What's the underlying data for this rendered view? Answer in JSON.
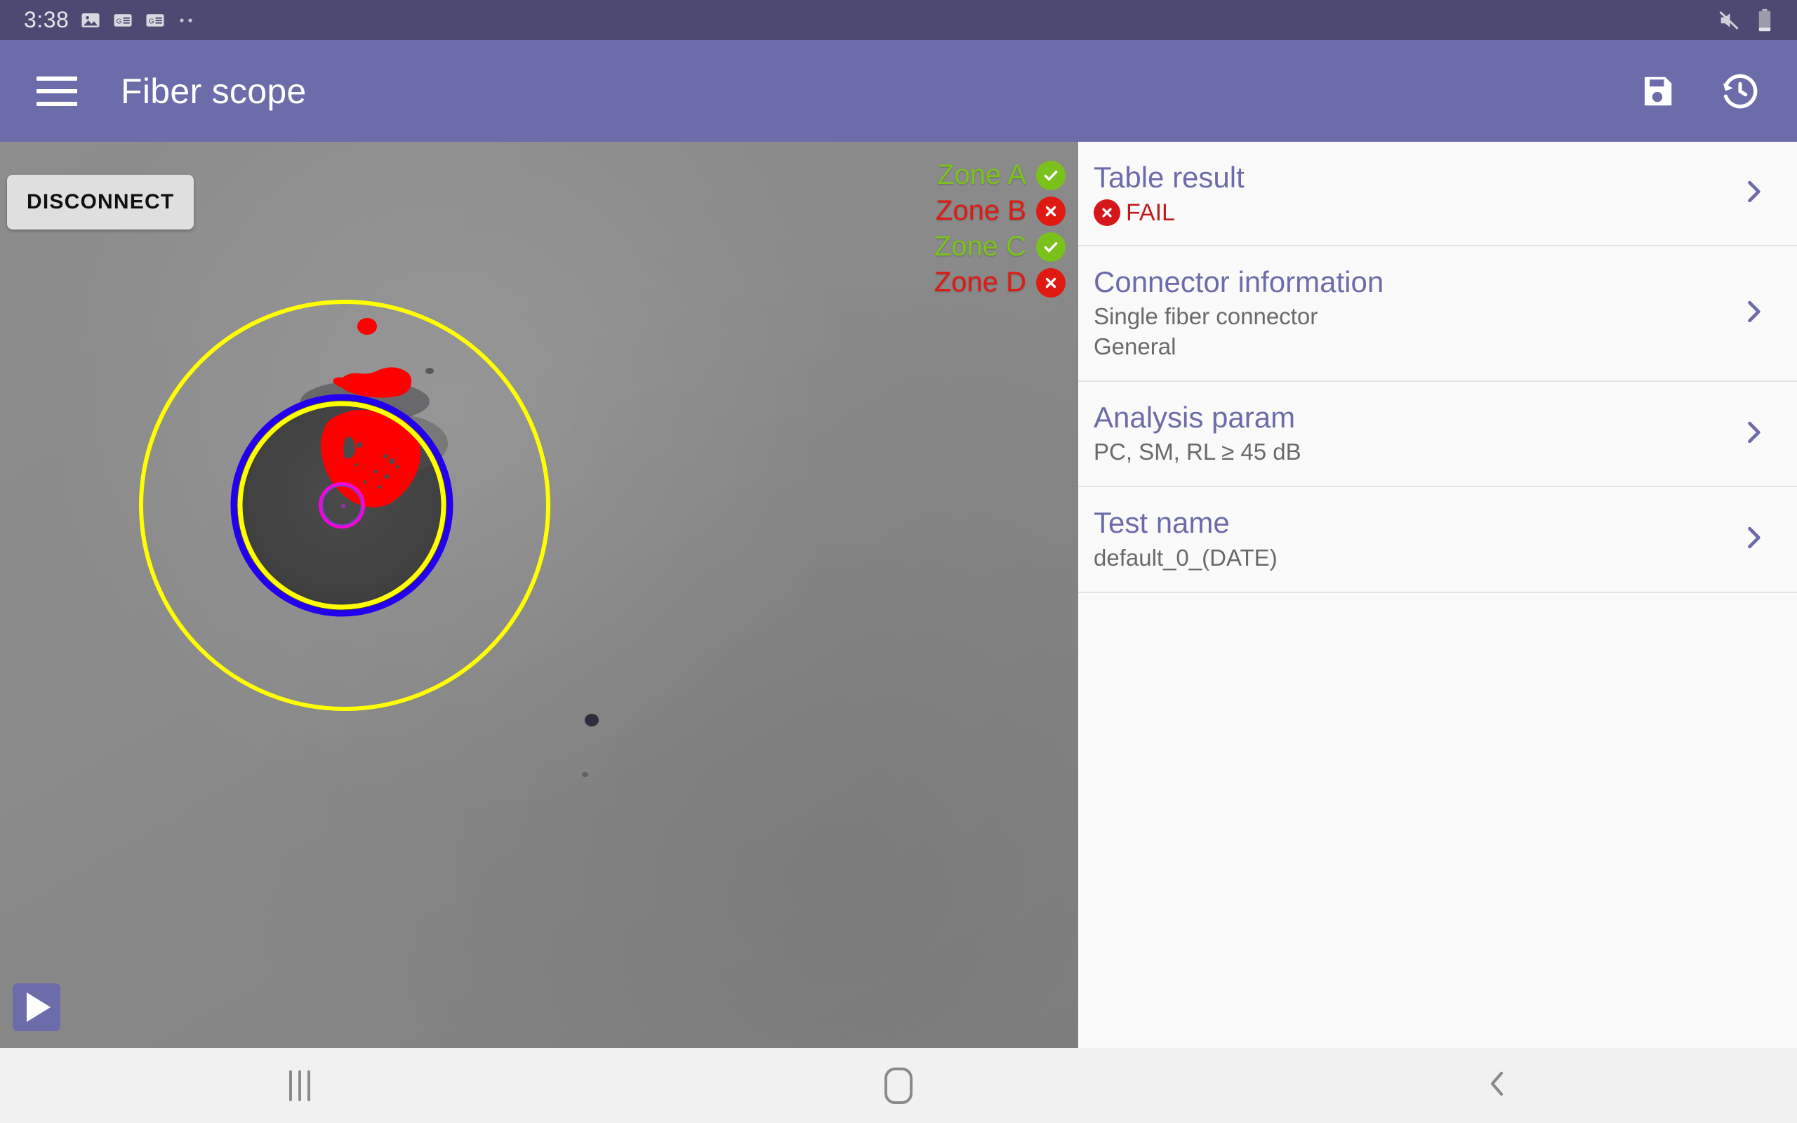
{
  "statusbar": {
    "time": "3:38",
    "left_icons": [
      "image-icon",
      "google-news-icon",
      "google-news-icon",
      "more-dots-icon"
    ],
    "right_icons": [
      "mute-icon",
      "battery-icon"
    ]
  },
  "appbar": {
    "menu_icon": "hamburger-menu-icon",
    "title": "Fiber scope",
    "save_icon": "save-icon",
    "history_icon": "history-icon"
  },
  "scope": {
    "disconnect_label": "DISCONNECT",
    "play_icon": "play-icon",
    "zones": [
      {
        "label": "Zone A",
        "status": "pass",
        "glyph": "✔"
      },
      {
        "label": "Zone B",
        "status": "fail",
        "glyph": "✕"
      },
      {
        "label": "Zone C",
        "status": "pass",
        "glyph": "✔"
      },
      {
        "label": "Zone D",
        "status": "fail",
        "glyph": "✕"
      }
    ],
    "overlay_colors": {
      "outer_ring": "#ffff00",
      "inner_ring": "#2200ee",
      "core_ring": "#ff00dd",
      "defect": "#ff0000"
    }
  },
  "panel": {
    "items": [
      {
        "title": "Table result",
        "result_text": "FAIL",
        "result_glyph": "✕",
        "sub1": "",
        "sub2": "",
        "chevron": "chevron-right-icon"
      },
      {
        "title": "Connector information",
        "sub1": "Single fiber connector",
        "sub2": "General",
        "chevron": "chevron-right-icon"
      },
      {
        "title": "Analysis param",
        "sub1": "PC, SM, RL ≥ 45 dB",
        "sub2": "",
        "chevron": "chevron-right-icon"
      },
      {
        "title": "Test name",
        "sub1": "default_0_(DATE)",
        "sub2": "",
        "chevron": "chevron-right-icon"
      }
    ]
  },
  "navbar": {
    "recents_label": "recents-icon",
    "home_label": "home-icon",
    "back_label": "back-icon"
  },
  "colors": {
    "status_bar": "#4c4a72",
    "app_bar": "#6d6caa",
    "accent": "#6d6caa",
    "pass": "#7ac11b",
    "fail": "#e01a13",
    "panel_bg": "#fafafa"
  }
}
